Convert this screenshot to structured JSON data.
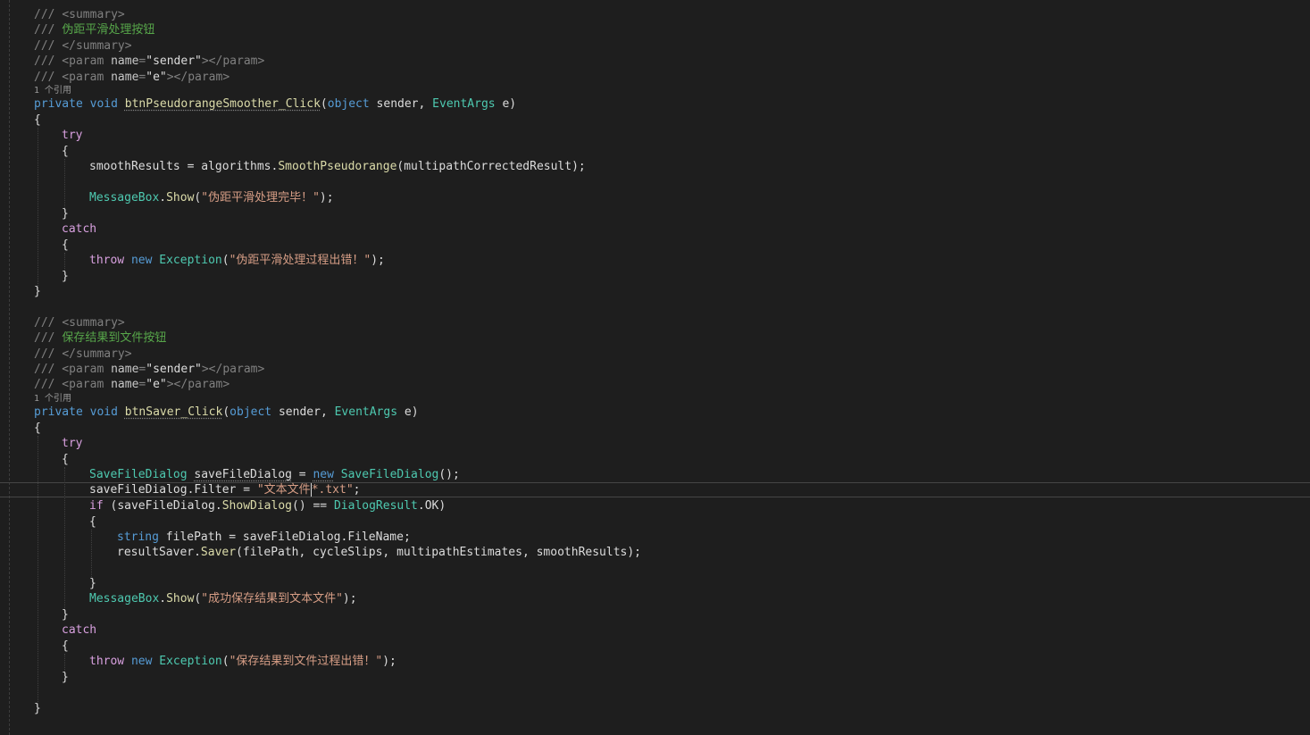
{
  "doc1": {
    "summary_open": "<summary>",
    "summary_text": "伪距平滑处理按钮",
    "summary_close": "</summary>",
    "param_sender": "sender",
    "param_e": "e"
  },
  "codelens1": "1 个引用",
  "method1": {
    "modifier": "private",
    "ret": "void",
    "name": "btnPseudorangeSmoother_Click",
    "param1_type": "object",
    "param1_name": "sender",
    "param2_type": "EventArgs",
    "param2_name": "e"
  },
  "body1": {
    "try_kw": "try",
    "assign_var": "smoothResults",
    "assign_obj": "algorithms",
    "assign_method": "SmoothPseudorange",
    "assign_arg": "multipathCorrectedResult",
    "msgbox_type": "MessageBox",
    "msgbox_method": "Show",
    "msg_success": "\"伪距平滑处理完毕！\"",
    "catch_kw": "catch",
    "throw_kw": "throw",
    "new_kw": "new",
    "exception_type": "Exception",
    "msg_error": "\"伪距平滑处理过程出错！\""
  },
  "doc2": {
    "summary_open": "<summary>",
    "summary_text": "保存结果到文件按钮",
    "summary_close": "</summary>",
    "param_sender": "sender",
    "param_e": "e"
  },
  "codelens2": "1 个引用",
  "method2": {
    "modifier": "private",
    "ret": "void",
    "name": "btnSaver_Click",
    "param1_type": "object",
    "param1_name": "sender",
    "param2_type": "EventArgs",
    "param2_name": "e"
  },
  "body2": {
    "try_kw": "try",
    "dialog_type": "SaveFileDialog",
    "dialog_var": "saveFileDialog",
    "new_kw": "new",
    "filter_prop": "Filter",
    "filter_str_a": "\"文本文件",
    "filter_str_b": "*.txt\"",
    "if_kw": "if",
    "showdialog_method": "ShowDialog",
    "dialogresult_type": "DialogResult",
    "dialogresult_value": "OK",
    "string_kw": "string",
    "filepath_var": "filePath",
    "filename_prop": "FileName",
    "saver_obj": "resultSaver",
    "saver_method": "Saver",
    "saver_args": "filePath, cycleSlips, multipathEstimates, smoothResults",
    "msgbox_type": "MessageBox",
    "msgbox_method": "Show",
    "msg_success": "\"成功保存结果到文本文件\"",
    "catch_kw": "catch",
    "throw_kw": "throw",
    "exception_type": "Exception",
    "msg_error": "\"保存结果到文件过程出错！\""
  },
  "colors": {
    "background": "#1e1e1e",
    "keyword": "#569cd6",
    "control": "#d8a0df",
    "type": "#4ec9b0",
    "string": "#d69d85",
    "method": "#dcdcaa",
    "comment": "#57a64a"
  }
}
